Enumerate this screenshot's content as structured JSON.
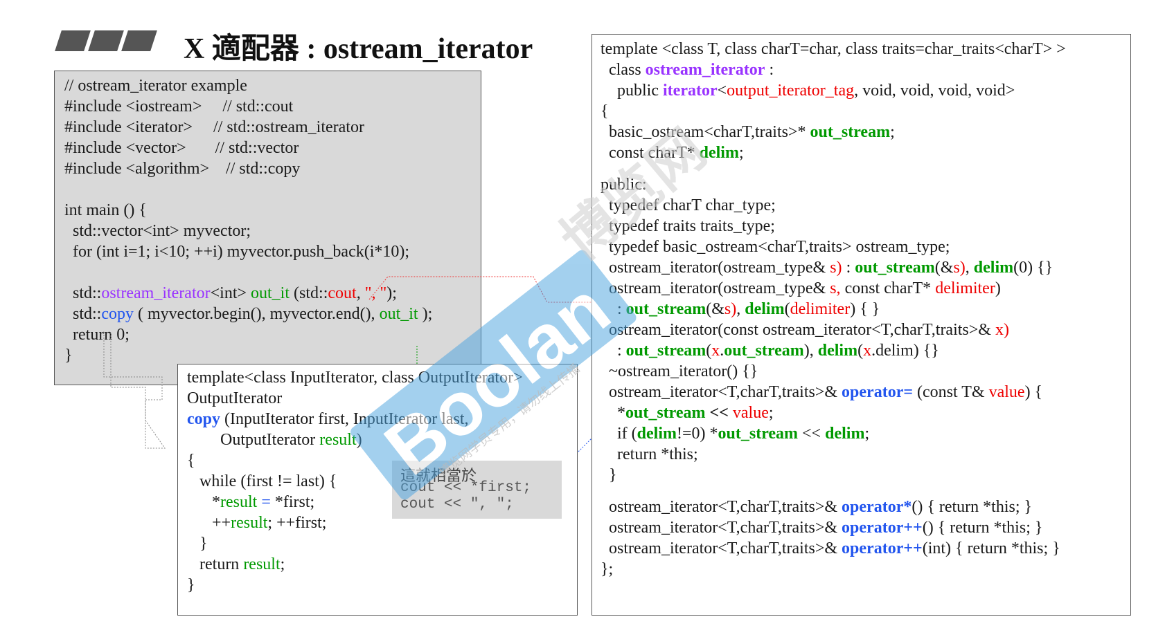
{
  "title": "X 適配器 : ostream_iterator",
  "example": {
    "lines": [
      "// ostream_iterator example",
      "#include <iostream>     // std::cout",
      "#include <iterator>     // std::ostream_iterator",
      "#include <vector>       // std::vector",
      "#include <algorithm>    // std::copy",
      "",
      "int main () {",
      "  std::vector<int> myvector;",
      "  for (int i=1; i<10; ++i) myvector.push_back(i*10);",
      "",
      "  std::ostream_iterator<int> out_it (std::cout, \", \");",
      "  std::copy ( myvector.begin(), myvector.end(), out_it );",
      "  return 0;",
      "}"
    ]
  },
  "copy_func": {
    "lines": [
      "template<class InputIterator, class OutputIterator>",
      "OutputIterator",
      "copy (InputIterator first, InputIterator last,",
      "        OutputIterator result)",
      "{",
      "   while (first != last) {",
      "      *result = *first;",
      "      ++result; ++first;",
      "   }",
      "   return result;",
      "}"
    ]
  },
  "callout": {
    "title": "這就相當於",
    "code_lines": [
      "cout << *first;",
      "cout << \", \";"
    ]
  },
  "ostream_iterator_def": {
    "lines": [
      "template <class T, class charT=char, class traits=char_traits<charT> >",
      "  class ostream_iterator :",
      "    public iterator<output_iterator_tag, void, void, void, void>",
      "{",
      "  basic_ostream<charT,traits>* out_stream;",
      "  const charT* delim;",
      "public:",
      "  typedef charT char_type;",
      "  typedef traits traits_type;",
      "  typedef basic_ostream<charT,traits> ostream_type;",
      "  ostream_iterator(ostream_type& s) : out_stream(&s), delim(0) {}",
      "  ostream_iterator(ostream_type& s, const charT* delimiter)",
      "    : out_stream(&s), delim(delimiter) { }",
      "  ostream_iterator(const ostream_iterator<T,charT,traits>& x)",
      "    : out_stream(x.out_stream), delim(x.delim) {}",
      "  ~ostream_iterator() {}",
      "  ostream_iterator<T,charT,traits>& operator= (const T& value) {",
      "    *out_stream << value;",
      "    if (delim!=0) *out_stream << delim;",
      "    return *this;",
      "  }",
      "  ostream_iterator<T,charT,traits>& operator*() { return *this; }",
      "  ostream_iterator<T,charT,traits>& operator++() { return *this; }",
      "  ostream_iterator<T,charT,traits>& operator++(int) { return *this; }",
      "};"
    ]
  },
  "watermark": {
    "main": "Boolan",
    "chinese": "博览网",
    "diagonal": "博览网学员专用，请勿线上传播"
  },
  "colors": {
    "purple": "#9933ff",
    "green": "#009900",
    "red": "#ee0000",
    "blue": "#2255ee",
    "watermark": "#4aa3df"
  }
}
